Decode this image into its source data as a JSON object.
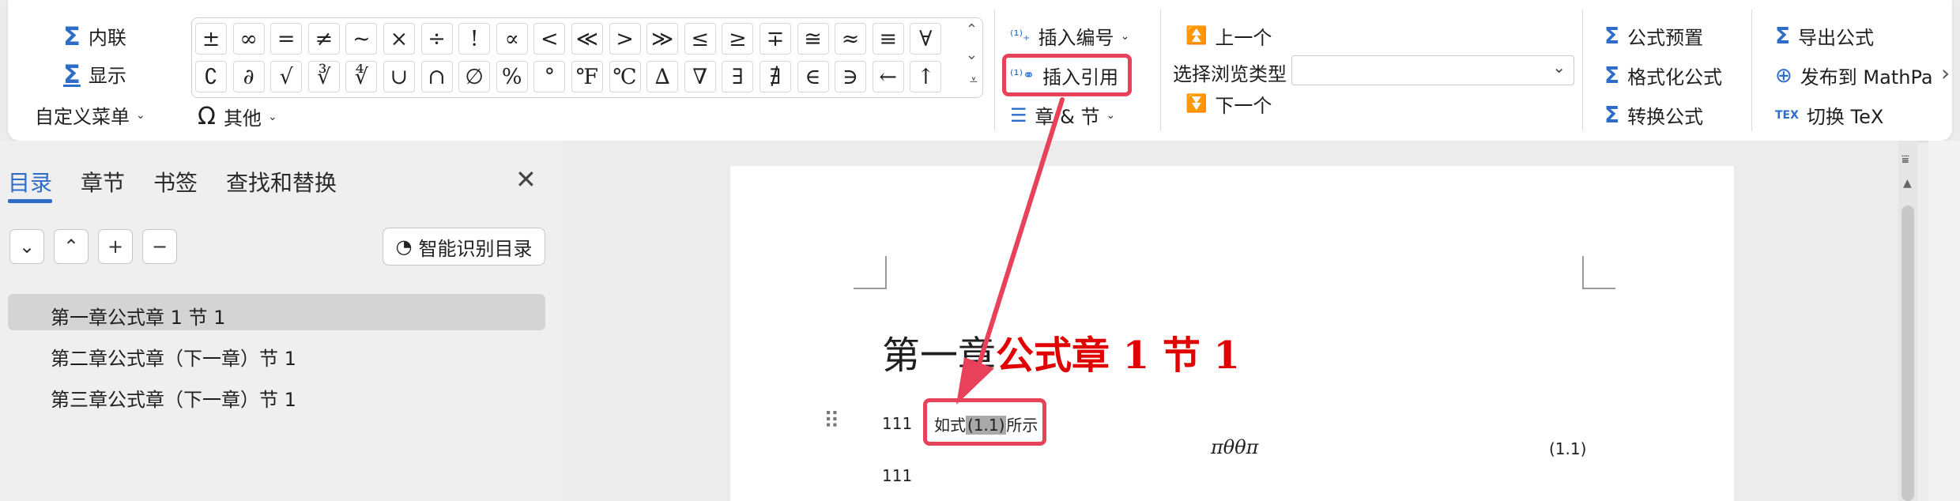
{
  "ribbon": {
    "mode_inline": "内联",
    "mode_display": "显示",
    "custom_menu": "自定义菜单",
    "symbols_row1": [
      "±",
      "∞",
      "=",
      "≠",
      "~",
      "×",
      "÷",
      "!",
      "∝",
      "<",
      "≪",
      ">",
      "≫",
      "≤",
      "≥",
      "∓",
      "≅",
      "≈",
      "≡",
      "∀"
    ],
    "symbols_row2": [
      "∁",
      "∂",
      "√",
      "∛",
      "∜",
      "∪",
      "∩",
      "∅",
      "%",
      "°",
      "℉",
      "℃",
      "∆",
      "∇",
      "∃",
      "∄",
      "∈",
      "∋",
      "←",
      "↑"
    ],
    "other": "其他",
    "insert_number": "插入编号",
    "insert_reference": "插入引用",
    "chapter_section": "章 & 节",
    "prev": "上一个",
    "browse_type": "选择浏览类型",
    "browse_type_value": "",
    "next": "下一个",
    "formula_preset": "公式预置",
    "format_formula": "格式化公式",
    "convert_formula": "转换公式",
    "export_formula": "导出公式",
    "publish": "发布到 MathPa",
    "switch_tex": "切换 TeX",
    "tex_glyph": "TEX"
  },
  "nav_pane": {
    "tabs": [
      "目录",
      "章节",
      "书签",
      "查找和替换"
    ],
    "active_tab": "目录",
    "tool_buttons": [
      "⌄",
      "⌃",
      "+",
      "−"
    ],
    "smart_toc": "智能识别目录",
    "toc_items": [
      "第一章公式章 1 节 1",
      "第二章公式章（下一章）节 1",
      "第三章公式章（下一章）节 1"
    ],
    "selected_index": 0
  },
  "document": {
    "heading_plain": "第一章",
    "heading_red": "公式章 1 节 1",
    "para_number_1": "111",
    "ref_prefix": "如式",
    "ref_value": "(1.1)",
    "ref_suffix": "所示",
    "formula": "πθθπ",
    "equation_number": "(1.1)",
    "para_number_2": "111"
  },
  "colors": {
    "accent_blue": "#2d6cc9",
    "annotation_red": "#e8415a",
    "heading_red": "#e10000"
  }
}
